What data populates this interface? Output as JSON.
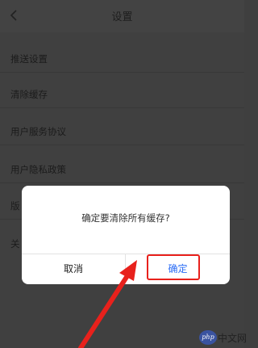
{
  "navbar": {
    "title": "设置",
    "back_icon": "chevron-left-icon"
  },
  "settings": {
    "items": [
      {
        "label": "推送设置"
      },
      {
        "label": "清除缓存"
      },
      {
        "label": "用户服务协议"
      },
      {
        "label": "用户隐私政策"
      },
      {
        "label": "版"
      },
      {
        "label": "关"
      }
    ]
  },
  "dialog": {
    "message": "确定要清除所有缓存?",
    "cancel_label": "取消",
    "confirm_label": "确定"
  },
  "annotation": {
    "color": "#e8211c"
  },
  "watermark": {
    "logo_text": "php",
    "site_text": "中文网"
  },
  "colors": {
    "background_dimmed": "#404040",
    "dialog_bg": "#ffffff",
    "confirm_blue": "#2a6cf5",
    "highlight_red": "#e8211c"
  }
}
